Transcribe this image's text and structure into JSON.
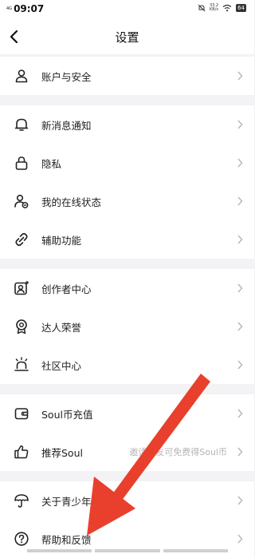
{
  "status_bar": {
    "network": "4G",
    "time": "09:07",
    "speed_value": "33.2",
    "speed_unit": "KB/s",
    "battery": "64"
  },
  "header": {
    "title": "设置"
  },
  "groups": [
    {
      "items": [
        {
          "label": "账户与安全",
          "icon": "user-icon"
        }
      ]
    },
    {
      "items": [
        {
          "label": "新消息通知",
          "icon": "bell-icon"
        },
        {
          "label": "隐私",
          "icon": "lock-icon"
        },
        {
          "label": "我的在线状态",
          "icon": "online-status-icon"
        },
        {
          "label": "辅助功能",
          "icon": "link-icon"
        }
      ]
    },
    {
      "items": [
        {
          "label": "创作者中心",
          "icon": "creator-icon"
        },
        {
          "label": "达人荣誉",
          "icon": "badge-icon"
        },
        {
          "label": "社区中心",
          "icon": "community-icon"
        }
      ]
    },
    {
      "items": [
        {
          "label": "Soul币充值",
          "icon": "wallet-icon"
        },
        {
          "label": "推荐Soul",
          "icon": "thumbs-up-icon",
          "hint": "邀请好友可免费得Soul币"
        }
      ]
    },
    {
      "items": [
        {
          "label": "关于青少年模式",
          "icon": "umbrella-icon"
        },
        {
          "label": "帮助和反馈",
          "icon": "help-icon"
        }
      ]
    }
  ],
  "colors": {
    "annotation_arrow": "#e8402c",
    "chevron": "#b5b5b5"
  }
}
